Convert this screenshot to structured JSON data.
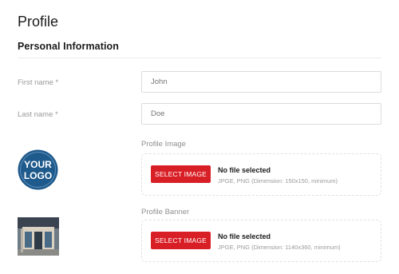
{
  "page": {
    "title": "Profile"
  },
  "section": {
    "title": "Personal Information"
  },
  "form": {
    "first_name": {
      "label": "First name *",
      "value": "",
      "placeholder": "John"
    },
    "last_name": {
      "label": "Last name *",
      "value": "",
      "placeholder": "Doe"
    },
    "profile_image": {
      "label": "Profile Image",
      "button_label": "SELECT IMAGE",
      "status": "No file selected",
      "hint": "JPGE, PNG (Dimension: 150x150, minimum)",
      "preview": {
        "text_line1": "YOUR",
        "text_line2": "LOGO"
      }
    },
    "profile_banner": {
      "label": "Profile Banner",
      "button_label": "SELECT IMAGE",
      "status": "No file selected",
      "hint": "JPGE, PNG (Dimension: 1140x360, minimum)"
    }
  },
  "colors": {
    "accent": "#d91f26",
    "logo_blue": "#1f5a8c"
  }
}
